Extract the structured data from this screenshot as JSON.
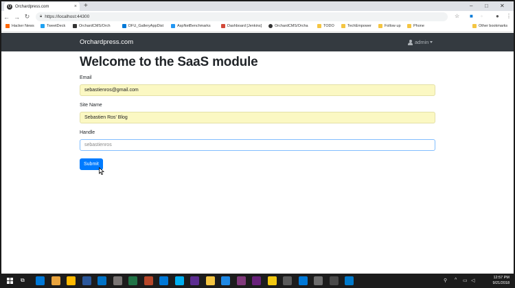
{
  "browser": {
    "tab_title": "Orchardpress.com",
    "tab_favicon": "O",
    "tab_close": "×",
    "new_tab": "+",
    "window_controls": [
      "–",
      "□",
      "✕"
    ],
    "url": "https://localhost:44300",
    "bookmarks": [
      {
        "label": "Apps",
        "color": "#e8710a"
      },
      {
        "label": "Hacker News",
        "color": "#f60"
      },
      {
        "label": "TweetDeck",
        "color": "#1da1f2"
      },
      {
        "label": "OrchardCMS/Orch",
        "color": "#333"
      },
      {
        "label": "DFU_GalleryAppDist",
        "color": "#0078d7"
      },
      {
        "label": "AspNetBenchmarks",
        "color": "#2196f3"
      },
      {
        "label": "Dashboard [Jenkins]",
        "color": "#d24939"
      },
      {
        "label": "OrchardCMS/Orcha",
        "color": "#333"
      },
      {
        "label": "TODO",
        "color": "#f4c542"
      },
      {
        "label": "TechEmpower",
        "color": "#f4c542"
      },
      {
        "label": "Follow up",
        "color": "#f4c542"
      },
      {
        "label": "Phone",
        "color": "#f4c542"
      },
      {
        "label": "Other bookmarks",
        "color": "#f4c542"
      }
    ]
  },
  "site": {
    "brand": "Orchardpress.com",
    "user": "admin"
  },
  "form": {
    "title": "Welcome to the SaaS module",
    "email_label": "Email",
    "email_value": "sebastienros@gmail.com",
    "site_name_label": "Site Name",
    "site_name_value": "Sebastien Ros' Blog",
    "handle_label": "Handle",
    "handle_value": "sebastienros",
    "submit_label": "Submit"
  },
  "taskbar": {
    "time": "12:57 PM",
    "date": "9/21/2018",
    "app_colors": [
      "#0078d7",
      "#e8a33d",
      "#ffb900",
      "#2b579a",
      "#0072c6",
      "#7a7574",
      "#217346",
      "#b7472a",
      "#0078d7",
      "#00aff0",
      "#5c2d91",
      "#f4c542",
      "#1e88e5",
      "#80397b",
      "#68217a",
      "#f2c811",
      "#5a5a5a",
      "#0078d7",
      "#6d6d6d",
      "#4a4a4a",
      "#007acc"
    ]
  }
}
